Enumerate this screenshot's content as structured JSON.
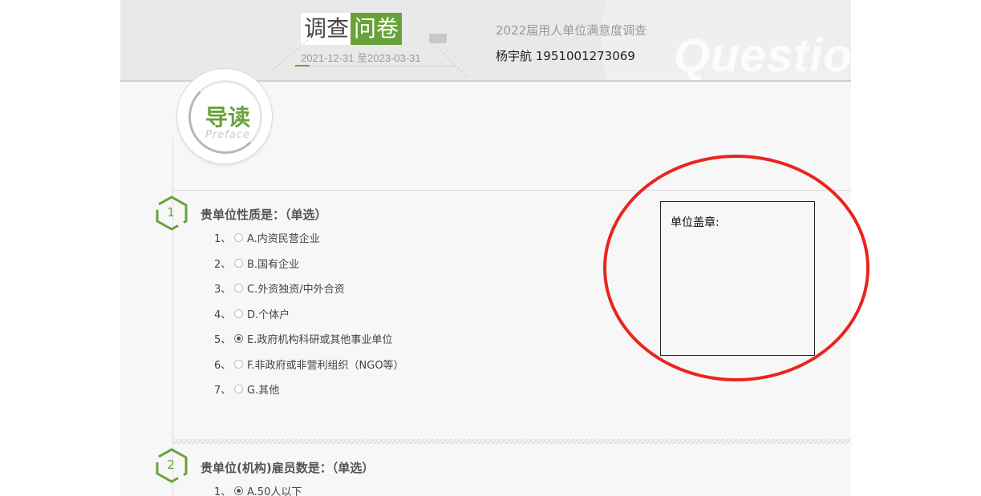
{
  "header": {
    "logo_part1": "调查",
    "logo_part2": "问卷",
    "date_range": "2021-12-31 至2023-03-31",
    "survey_title": "2022届用人单位满意度调查",
    "respondent": "杨宇航 1951001273069",
    "bg_word": "Questio"
  },
  "preface": {
    "zh": "导读",
    "en": "Preface"
  },
  "stamp": {
    "label": "单位盖章:"
  },
  "questions": [
    {
      "number": "1",
      "title": "贵单位性质是：（单选）",
      "options": [
        {
          "idx": "1、",
          "label": "A.内资民营企业",
          "selected": false
        },
        {
          "idx": "2、",
          "label": "B.国有企业",
          "selected": false
        },
        {
          "idx": "3、",
          "label": "C.外资独资/中外合资",
          "selected": false
        },
        {
          "idx": "4、",
          "label": "D.个体户",
          "selected": false
        },
        {
          "idx": "5、",
          "label": "E.政府机构科研或其他事业单位",
          "selected": true
        },
        {
          "idx": "6、",
          "label": "F.非政府或非营利组织（NGO等）",
          "selected": false
        },
        {
          "idx": "7、",
          "label": "G.其他",
          "selected": false
        }
      ]
    },
    {
      "number": "2",
      "title": "贵单位(机构)雇员数是：（单选）",
      "options": [
        {
          "idx": "1、",
          "label": "A.50人以下",
          "selected": true
        }
      ]
    }
  ],
  "colors": {
    "accent_green": "#6aa23a",
    "annotation_red": "#e8261e"
  }
}
